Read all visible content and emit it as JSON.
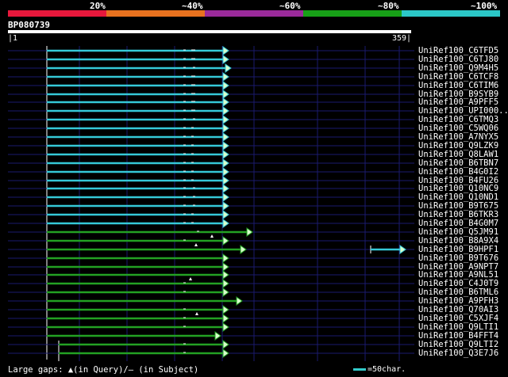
{
  "header": {
    "percent_labels": [
      "20%",
      "~40%",
      "~60%",
      "~80%",
      "~100%"
    ],
    "bar_colors": [
      "#e8183c",
      "#e8721f",
      "#9a2a9a",
      "#17a017",
      "#2bc7c7"
    ]
  },
  "query": {
    "title": "BP080739",
    "start_label": "|1",
    "end_label": "359|"
  },
  "colors": {
    "cyan_hit": "#35c9d8",
    "green_hit": "#23a123",
    "head_fill": "#d8ffcc",
    "guide_line": "#1a1a6e",
    "dash_tick": "#ffffff"
  },
  "hits": [
    {
      "name": "UniRef100_C6TFD5",
      "color": "cyan"
    },
    {
      "name": "UniRef100_C6TJ80",
      "color": "cyan"
    },
    {
      "name": "UniRef100_Q9M4H5",
      "color": "cyan"
    },
    {
      "name": "UniRef100_C6TCF8",
      "color": "cyan"
    },
    {
      "name": "UniRef100_C6TIM6",
      "color": "cyan"
    },
    {
      "name": "UniRef100_B9SYB9",
      "color": "cyan"
    },
    {
      "name": "UniRef100_A9PFF5",
      "color": "cyan"
    },
    {
      "name": "UniRef100_UPI000..",
      "color": "cyan"
    },
    {
      "name": "UniRef100_C6TMQ3",
      "color": "cyan"
    },
    {
      "name": "UniRef100_C5WQ06",
      "color": "cyan"
    },
    {
      "name": "UniRef100_A7NYX5",
      "color": "cyan"
    },
    {
      "name": "UniRef100_Q9LZK9",
      "color": "cyan"
    },
    {
      "name": "UniRef100_Q8LAW1",
      "color": "cyan"
    },
    {
      "name": "UniRef100_B6TBN7",
      "color": "cyan"
    },
    {
      "name": "UniRef100_B4G0I2",
      "color": "cyan"
    },
    {
      "name": "UniRef100_B4FU26",
      "color": "cyan"
    },
    {
      "name": "UniRef100_Q10NC9",
      "color": "cyan"
    },
    {
      "name": "UniRef100_Q10ND1",
      "color": "cyan"
    },
    {
      "name": "UniRef100_B9T675",
      "color": "cyan"
    },
    {
      "name": "UniRef100_B6TKR3",
      "color": "cyan"
    },
    {
      "name": "UniRef100_B4G0M7",
      "color": "cyan"
    },
    {
      "name": "UniRef100_Q5JM91",
      "color": "green"
    },
    {
      "name": "UniRef100_B8A9X4",
      "color": "green"
    },
    {
      "name": "UniRef100_B9HPF1",
      "color": "green"
    },
    {
      "name": "UniRef100_B9T676",
      "color": "green"
    },
    {
      "name": "UniRef100_A9NPT7",
      "color": "green"
    },
    {
      "name": "UniRef100_A9NL51",
      "color": "green"
    },
    {
      "name": "UniRef100_C4J0T9",
      "color": "green"
    },
    {
      "name": "UniRef100_B6TML6",
      "color": "green"
    },
    {
      "name": "UniRef100_A9PFH3",
      "color": "green"
    },
    {
      "name": "UniRef100_Q70AI3",
      "color": "green"
    },
    {
      "name": "UniRef100_C5XJF4",
      "color": "green"
    },
    {
      "name": "UniRef100_Q9LTI1",
      "color": "green"
    },
    {
      "name": "UniRef100_B4FFT4",
      "color": "green"
    },
    {
      "name": "UniRef100_Q9LTI2",
      "color": "green"
    },
    {
      "name": "UniRef100_Q3E7J6",
      "color": "green"
    }
  ],
  "legend": {
    "gaps_text": "Large gaps: ▲(in Query)/– (in Subject)",
    "scale_text": "=50char."
  }
}
